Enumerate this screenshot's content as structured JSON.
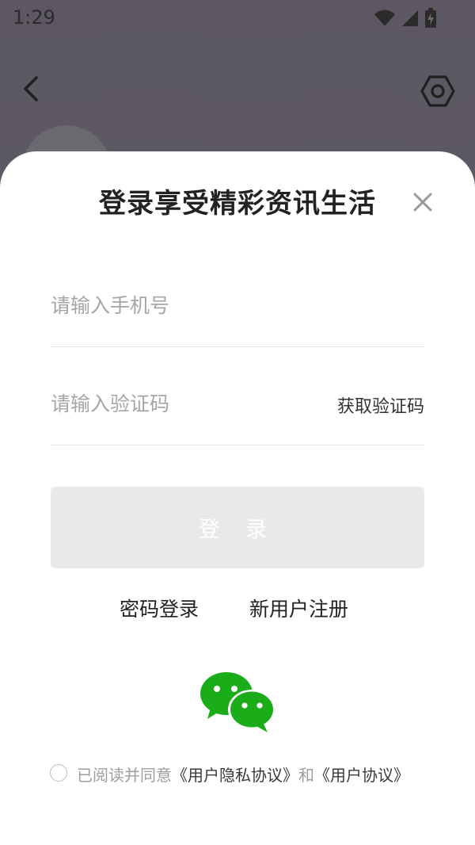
{
  "status_bar": {
    "time": "1:29",
    "icons": [
      "wifi-icon",
      "cellular-signal-icon",
      "battery-charging-icon"
    ]
  },
  "top_bar": {
    "back_icon": "chevron-left-icon",
    "settings_icon": "hexagon-settings-icon"
  },
  "login_sheet": {
    "title": "登录享受精彩资讯生活",
    "close_icon": "close-icon",
    "phone_placeholder": "请输入手机号",
    "phone_value": "",
    "code_placeholder": "请输入验证码",
    "code_value": "",
    "get_code_label": "获取验证码",
    "login_label": "登 录",
    "password_login_label": "密码登录",
    "register_label": "新用户注册",
    "wechat_icon": "wechat-icon",
    "agreement": {
      "prefix": "已阅读并同意",
      "privacy_link": "《用户隐私协议》",
      "conjunction": "和",
      "user_link": "《用户协议》"
    }
  },
  "colors": {
    "backdrop": "#5f5b66",
    "sheet": "#ffffff",
    "login_button_bg": "#e9e9e9",
    "wechat_green": "#1aad19",
    "divider": "#e6e6e6"
  }
}
